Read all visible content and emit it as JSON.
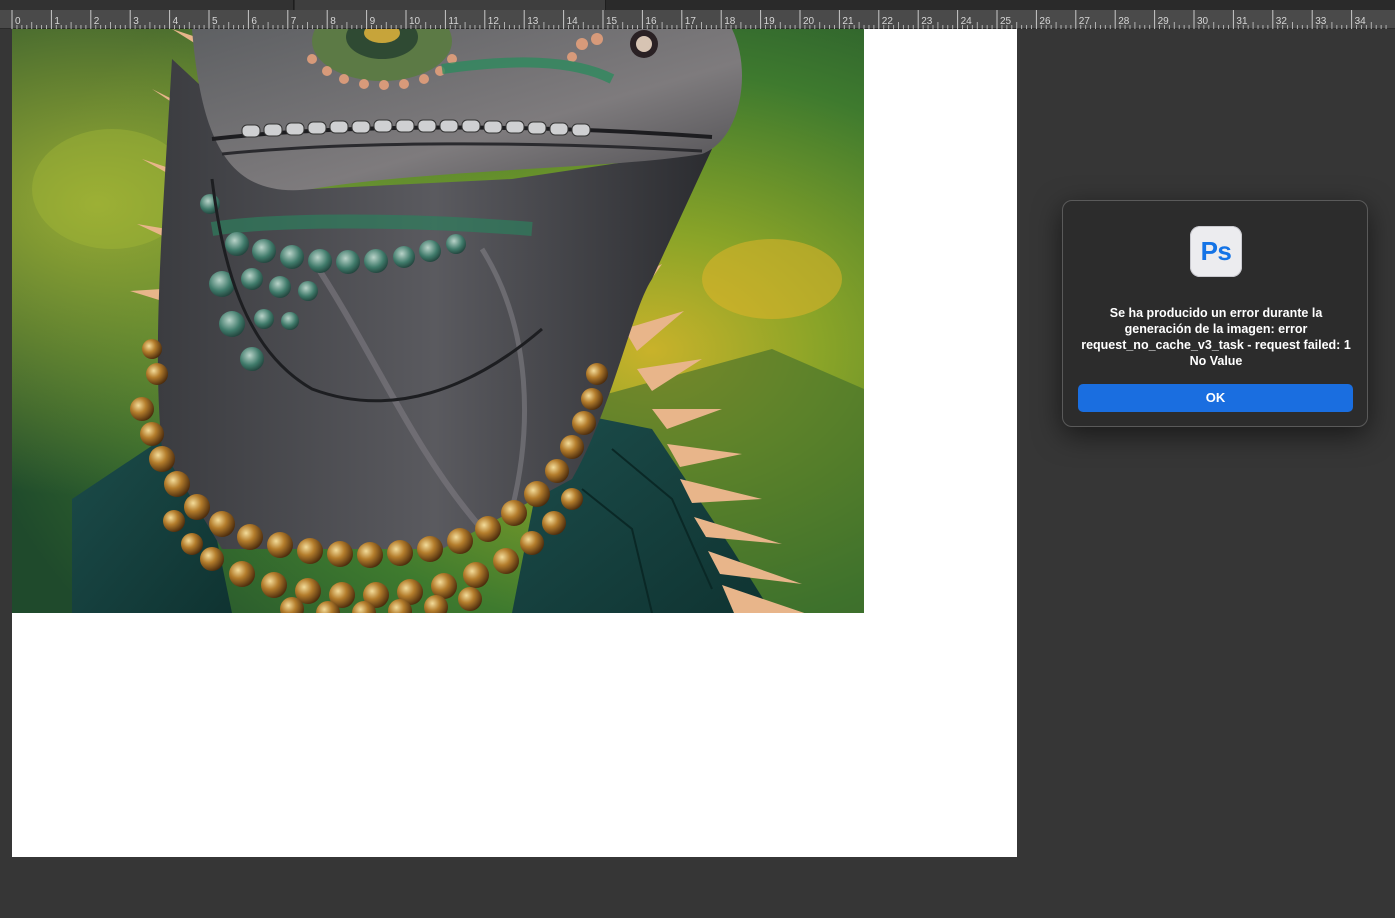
{
  "ruler": {
    "labels": [
      "0",
      "1",
      "2",
      "3",
      "4",
      "5",
      "6",
      "7",
      "8",
      "9",
      "10",
      "11",
      "12",
      "13",
      "14",
      "15",
      "16",
      "17",
      "18",
      "19",
      "20",
      "21",
      "22",
      "23",
      "24",
      "25",
      "26",
      "27",
      "28",
      "29",
      "30",
      "31",
      "32",
      "33",
      "34"
    ]
  },
  "dialog": {
    "app_icon_text": "Ps",
    "message": "Se ha producido un error durante la generación de la imagen: error request_no_cache_v3_task - request failed: 1 No Value",
    "ok_label": "OK"
  },
  "colors": {
    "workspace": "#363636",
    "ruler": "#4a4a4a",
    "dialog_bg": "#2c2c2c",
    "accent_blue": "#1a6ee0",
    "ps_icon_blue": "#1473e6",
    "canvas": "#ffffff"
  }
}
